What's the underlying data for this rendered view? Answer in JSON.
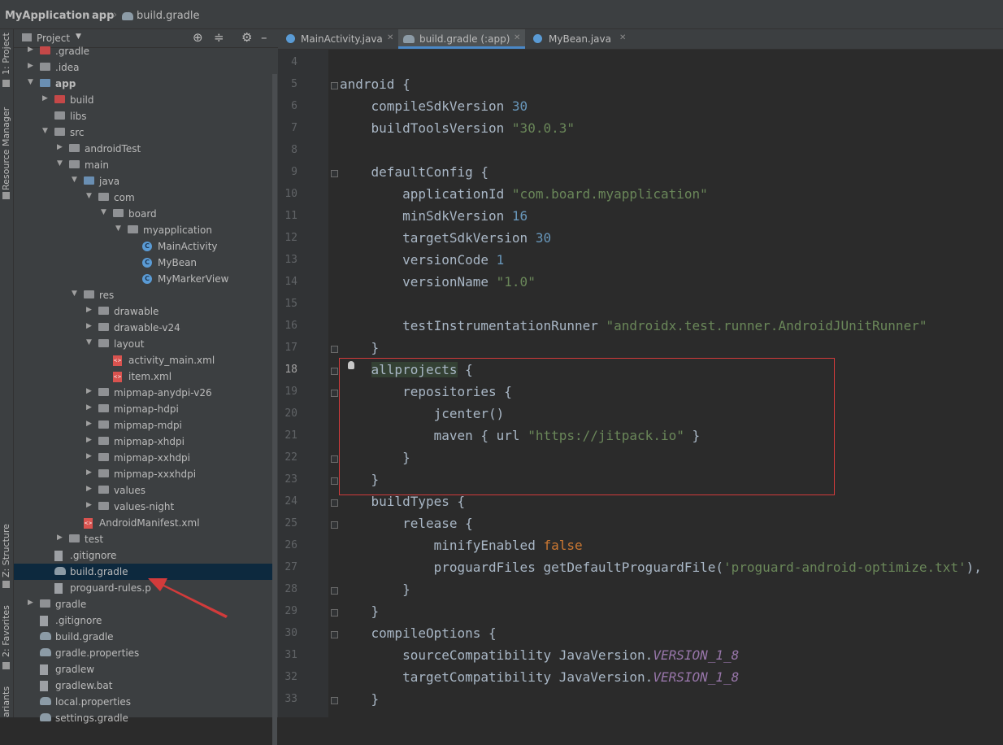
{
  "breadcrumb": {
    "project": "MyApplication",
    "module": "app",
    "file": "build.gradle"
  },
  "left_strip": {
    "project": "1: Project",
    "resource_manager": "Resource Manager",
    "structure": "Z: Structure",
    "favorites": "2: Favorites",
    "variants": "ariants"
  },
  "panel": {
    "title": "Project"
  },
  "tree": [
    {
      "label": ".gradle",
      "depth": 1,
      "icon": "folder-red",
      "arrow": "right"
    },
    {
      "label": ".idea",
      "depth": 1,
      "icon": "folder",
      "arrow": "right"
    },
    {
      "label": "app",
      "depth": 1,
      "icon": "folder-blue",
      "arrow": "down",
      "bold": true
    },
    {
      "label": "build",
      "depth": 2,
      "icon": "folder-red",
      "arrow": "right"
    },
    {
      "label": "libs",
      "depth": 2,
      "icon": "folder",
      "arrow": ""
    },
    {
      "label": "src",
      "depth": 2,
      "icon": "folder",
      "arrow": "down"
    },
    {
      "label": "androidTest",
      "depth": 3,
      "icon": "folder",
      "arrow": "right"
    },
    {
      "label": "main",
      "depth": 3,
      "icon": "folder",
      "arrow": "down"
    },
    {
      "label": "java",
      "depth": 4,
      "icon": "folder-blue",
      "arrow": "down"
    },
    {
      "label": "com",
      "depth": 5,
      "icon": "folder",
      "arrow": "down"
    },
    {
      "label": "board",
      "depth": 6,
      "icon": "folder",
      "arrow": "down"
    },
    {
      "label": "myapplication",
      "depth": 7,
      "icon": "folder",
      "arrow": "down"
    },
    {
      "label": "MainActivity",
      "depth": 8,
      "icon": "class",
      "arrow": ""
    },
    {
      "label": "MyBean",
      "depth": 8,
      "icon": "class",
      "arrow": ""
    },
    {
      "label": "MyMarkerView",
      "depth": 8,
      "icon": "class",
      "arrow": ""
    },
    {
      "label": "res",
      "depth": 4,
      "icon": "folder",
      "arrow": "down"
    },
    {
      "label": "drawable",
      "depth": 5,
      "icon": "folder",
      "arrow": "right"
    },
    {
      "label": "drawable-v24",
      "depth": 5,
      "icon": "folder",
      "arrow": "right"
    },
    {
      "label": "layout",
      "depth": 5,
      "icon": "folder",
      "arrow": "down"
    },
    {
      "label": "activity_main.xml",
      "depth": 6,
      "icon": "xml",
      "arrow": ""
    },
    {
      "label": "item.xml",
      "depth": 6,
      "icon": "xml",
      "arrow": ""
    },
    {
      "label": "mipmap-anydpi-v26",
      "depth": 5,
      "icon": "folder",
      "arrow": "right"
    },
    {
      "label": "mipmap-hdpi",
      "depth": 5,
      "icon": "folder",
      "arrow": "right"
    },
    {
      "label": "mipmap-mdpi",
      "depth": 5,
      "icon": "folder",
      "arrow": "right"
    },
    {
      "label": "mipmap-xhdpi",
      "depth": 5,
      "icon": "folder",
      "arrow": "right"
    },
    {
      "label": "mipmap-xxhdpi",
      "depth": 5,
      "icon": "folder",
      "arrow": "right"
    },
    {
      "label": "mipmap-xxxhdpi",
      "depth": 5,
      "icon": "folder",
      "arrow": "right"
    },
    {
      "label": "values",
      "depth": 5,
      "icon": "folder",
      "arrow": "right"
    },
    {
      "label": "values-night",
      "depth": 5,
      "icon": "folder",
      "arrow": "right"
    },
    {
      "label": "AndroidManifest.xml",
      "depth": 4,
      "icon": "xml",
      "arrow": ""
    },
    {
      "label": "test",
      "depth": 3,
      "icon": "folder",
      "arrow": "right"
    },
    {
      "label": ".gitignore",
      "depth": 2,
      "icon": "file",
      "arrow": ""
    },
    {
      "label": "build.gradle",
      "depth": 2,
      "icon": "gradle",
      "arrow": "",
      "selected": true
    },
    {
      "label": "proguard-rules.p",
      "depth": 2,
      "icon": "file",
      "arrow": ""
    },
    {
      "label": "gradle",
      "depth": 1,
      "icon": "folder",
      "arrow": "right"
    },
    {
      "label": ".gitignore",
      "depth": 1,
      "icon": "file",
      "arrow": ""
    },
    {
      "label": "build.gradle",
      "depth": 1,
      "icon": "gradle",
      "arrow": ""
    },
    {
      "label": "gradle.properties",
      "depth": 1,
      "icon": "gradle",
      "arrow": ""
    },
    {
      "label": "gradlew",
      "depth": 1,
      "icon": "file",
      "arrow": ""
    },
    {
      "label": "gradlew.bat",
      "depth": 1,
      "icon": "file",
      "arrow": ""
    },
    {
      "label": "local.properties",
      "depth": 1,
      "icon": "gradle",
      "arrow": ""
    },
    {
      "label": "settings.gradle",
      "depth": 1,
      "icon": "gradle",
      "arrow": ""
    }
  ],
  "tabs": [
    {
      "label": "MainActivity.java",
      "icon": "class",
      "active": false
    },
    {
      "label": "build.gradle (:app)",
      "icon": "gradle",
      "active": true
    },
    {
      "label": "MyBean.java",
      "icon": "class",
      "active": false
    }
  ],
  "editor": {
    "current_line": 18,
    "lines": [
      {
        "n": 4,
        "t": [
          {
            "s": ""
          }
        ]
      },
      {
        "n": 5,
        "t": [
          {
            "s": "android {"
          }
        ]
      },
      {
        "n": 6,
        "t": [
          {
            "s": "    compileSdkVersion "
          },
          {
            "s": "30",
            "c": "num"
          }
        ]
      },
      {
        "n": 7,
        "t": [
          {
            "s": "    buildToolsVersion "
          },
          {
            "s": "\"30.0.3\"",
            "c": "str"
          }
        ]
      },
      {
        "n": 8,
        "t": [
          {
            "s": ""
          }
        ]
      },
      {
        "n": 9,
        "t": [
          {
            "s": "    defaultConfig {"
          }
        ]
      },
      {
        "n": 10,
        "t": [
          {
            "s": "        applicationId "
          },
          {
            "s": "\"com.board.myapplication\"",
            "c": "str"
          }
        ]
      },
      {
        "n": 11,
        "t": [
          {
            "s": "        minSdkVersion "
          },
          {
            "s": "16",
            "c": "num"
          }
        ]
      },
      {
        "n": 12,
        "t": [
          {
            "s": "        targetSdkVersion "
          },
          {
            "s": "30",
            "c": "num"
          }
        ]
      },
      {
        "n": 13,
        "t": [
          {
            "s": "        versionCode "
          },
          {
            "s": "1",
            "c": "num"
          }
        ]
      },
      {
        "n": 14,
        "t": [
          {
            "s": "        versionName "
          },
          {
            "s": "\"1.0\"",
            "c": "str"
          }
        ]
      },
      {
        "n": 15,
        "t": [
          {
            "s": ""
          }
        ]
      },
      {
        "n": 16,
        "t": [
          {
            "s": "        testInstrumentationRunner "
          },
          {
            "s": "\"androidx.test.runner.AndroidJUnitRunner\"",
            "c": "str"
          }
        ]
      },
      {
        "n": 17,
        "t": [
          {
            "s": "    }"
          }
        ]
      },
      {
        "n": 18,
        "t": [
          {
            "s": "    "
          },
          {
            "s": "allprojects",
            "c": "hl"
          },
          {
            "s": " {"
          }
        ]
      },
      {
        "n": 19,
        "t": [
          {
            "s": "        repositories {"
          }
        ]
      },
      {
        "n": 20,
        "t": [
          {
            "s": "            jcenter()"
          }
        ]
      },
      {
        "n": 21,
        "t": [
          {
            "s": "            maven { url "
          },
          {
            "s": "\"https://jitpack.io\"",
            "c": "str"
          },
          {
            "s": " }"
          }
        ]
      },
      {
        "n": 22,
        "t": [
          {
            "s": "        }"
          }
        ]
      },
      {
        "n": 23,
        "t": [
          {
            "s": "    }"
          }
        ]
      },
      {
        "n": 24,
        "t": [
          {
            "s": "    buildTypes {"
          }
        ]
      },
      {
        "n": 25,
        "t": [
          {
            "s": "        release {"
          }
        ]
      },
      {
        "n": 26,
        "t": [
          {
            "s": "            minifyEnabled "
          },
          {
            "s": "false",
            "c": "kw"
          }
        ]
      },
      {
        "n": 27,
        "t": [
          {
            "s": "            proguardFiles getDefaultProguardFile("
          },
          {
            "s": "'proguard-android-optimize.txt'",
            "c": "str"
          },
          {
            "s": "),"
          }
        ]
      },
      {
        "n": 28,
        "t": [
          {
            "s": "        }"
          }
        ]
      },
      {
        "n": 29,
        "t": [
          {
            "s": "    }"
          }
        ]
      },
      {
        "n": 30,
        "t": [
          {
            "s": "    compileOptions {"
          }
        ]
      },
      {
        "n": 31,
        "t": [
          {
            "s": "        sourceCompatibility JavaVersion."
          },
          {
            "s": "VERSION_1_8",
            "c": "it"
          }
        ]
      },
      {
        "n": 32,
        "t": [
          {
            "s": "        targetCompatibility JavaVersion."
          },
          {
            "s": "VERSION_1_8",
            "c": "it"
          }
        ]
      },
      {
        "n": 33,
        "t": [
          {
            "s": "    }"
          }
        ]
      }
    ]
  }
}
